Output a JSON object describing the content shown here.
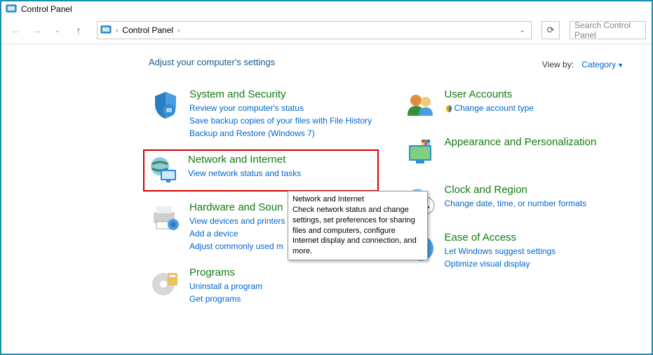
{
  "window": {
    "title": "Control Panel"
  },
  "breadcrumb": {
    "root": "Control Panel"
  },
  "search": {
    "placeholder": "Search Control Panel"
  },
  "heading": "Adjust your computer's settings",
  "viewby": {
    "label": "View by:",
    "value": "Category"
  },
  "left": [
    {
      "title": "System and Security",
      "links": [
        "Review your computer's status",
        "Save backup copies of your files with File History",
        "Backup and Restore (Windows 7)"
      ]
    },
    {
      "title": "Network and Internet",
      "links": [
        "View network status and tasks"
      ]
    },
    {
      "title": "Hardware and Sound",
      "links": [
        "View devices and printers",
        "Add a device",
        "Adjust commonly used mobility settings"
      ],
      "truncated": [
        "Hardware and Soun",
        "View devices and printers",
        "Add a device",
        "Adjust commonly used m"
      ]
    },
    {
      "title": "Programs",
      "links": [
        "Uninstall a program",
        "Get programs"
      ]
    }
  ],
  "right": [
    {
      "title": "User Accounts",
      "links": [
        "Change account type"
      ],
      "badge": true
    },
    {
      "title": "Appearance and Personalization",
      "links": []
    },
    {
      "title": "Clock and Region",
      "links": [
        "Change date, time, or number formats"
      ]
    },
    {
      "title": "Ease of Access",
      "links": [
        "Let Windows suggest settings",
        "Optimize visual display"
      ]
    }
  ],
  "tooltip": {
    "title": "Network and Internet",
    "body": "Check network status and change settings, set preferences for sharing files and computers, configure Internet display and connection, and more."
  }
}
